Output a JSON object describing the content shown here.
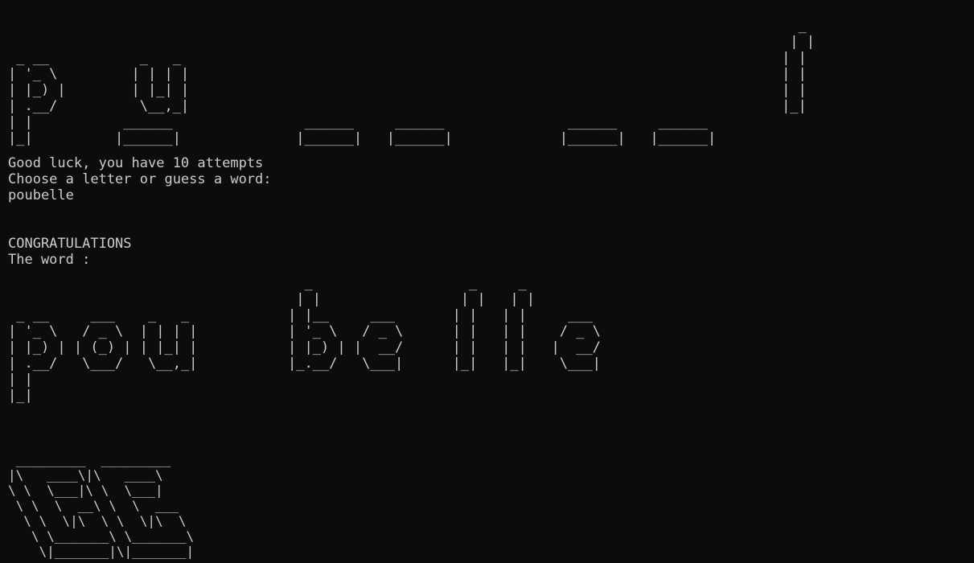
{
  "terminal": {
    "colors": {
      "background": "#0c0c0c",
      "text": "#cccccc"
    },
    "masked_word_art": [
      "                                                                                                _",
      "                                                                                               | |",
      " _ __           _   _                                                                         | |",
      "| '_ \\         | | | |                                                                        | |",
      "| |_) |        | |_| |                                                                        | |",
      "| .__/          \\__,_|                                                                        |_|",
      "| |           ______                ______     ______               ______     ______",
      "|_|          |______|              |______|   |______|             |______|   |______|"
    ],
    "status_lines": [
      "Good luck, you have 10 attempts",
      "Choose a letter or guess a word:",
      "poubelle"
    ],
    "result_lines": [
      "CONGRATULATIONS",
      "The word :"
    ],
    "revealed_word_art": [
      "                                    _                   _     _",
      "                                   | |                 | |   | |",
      " _ __     ___    _   _            | |__     ___       | |   | |     ___",
      "| '_ \\   / _ \\  | | | |           | '_ \\   / _ \\      | |   | |    / _ \\",
      "| |_) | | (_) | | |_| |           | |_) | |  __/      | |   | |   |  __/",
      "| .__/   \\___/   \\__,_|           |_.__/   \\___|      |_|   |_|    \\___|",
      "| |",
      "|_|"
    ],
    "logo_art": [
      " _________  _________",
      "|\\   ____\\|\\   ____\\",
      "\\ \\  \\___|\\ \\  \\___|",
      " \\ \\  \\  __\\ \\  \\  ___",
      "  \\ \\  \\|\\  \\ \\  \\|\\  \\",
      "   \\ \\_______\\ \\_______\\",
      "    \\|_______|\\|_______|"
    ]
  }
}
